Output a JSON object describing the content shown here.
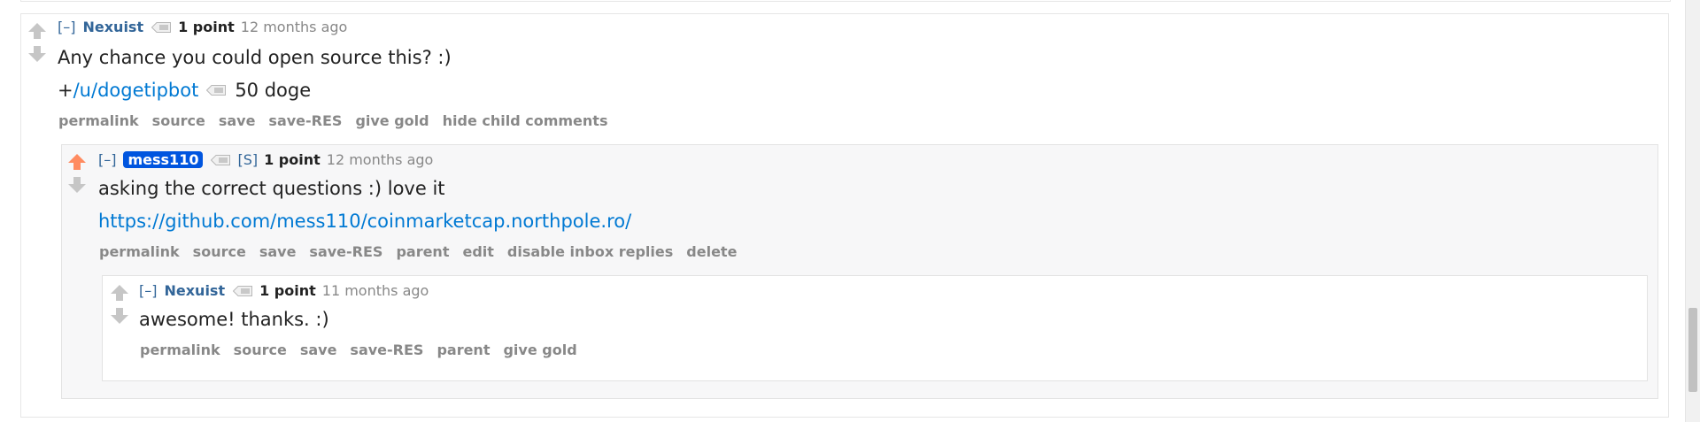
{
  "comments": [
    {
      "toggle": "[–]",
      "author": "Nexuist",
      "score": "1 point",
      "time": "12 months ago",
      "body_text": "Any chance you could open source this? :)",
      "tip": {
        "plus": "+",
        "user_link": "/u/dogetipbot",
        "amount": "50 doge"
      },
      "buttons": [
        "permalink",
        "source",
        "save",
        "save-RES",
        "give gold",
        "hide child comments"
      ]
    },
    {
      "toggle": "[–]",
      "author": "mess110",
      "submitter_flag": "[S]",
      "score": "1 point",
      "time": "12 months ago",
      "body_text": "asking the correct questions :) love it",
      "link": "https://github.com/mess110/coinmarketcap.northpole.ro/",
      "buttons": [
        "permalink",
        "source",
        "save",
        "save-RES",
        "parent",
        "edit",
        "disable inbox replies",
        "delete"
      ]
    },
    {
      "toggle": "[–]",
      "author": "Nexuist",
      "score": "1 point",
      "time": "11 months ago",
      "body_text": "awesome! thanks. :)",
      "buttons": [
        "permalink",
        "source",
        "save",
        "save-RES",
        "parent",
        "give gold"
      ]
    }
  ],
  "colors": {
    "upvoted": "#ff8b60",
    "arrow_default": "#c6c6c6",
    "link": "#0079d3",
    "author": "#336699",
    "submitter_bg": "#0055df"
  },
  "icons": {
    "upvote": "up-arrow-icon",
    "downvote": "down-arrow-icon",
    "tag": "tag-icon"
  }
}
